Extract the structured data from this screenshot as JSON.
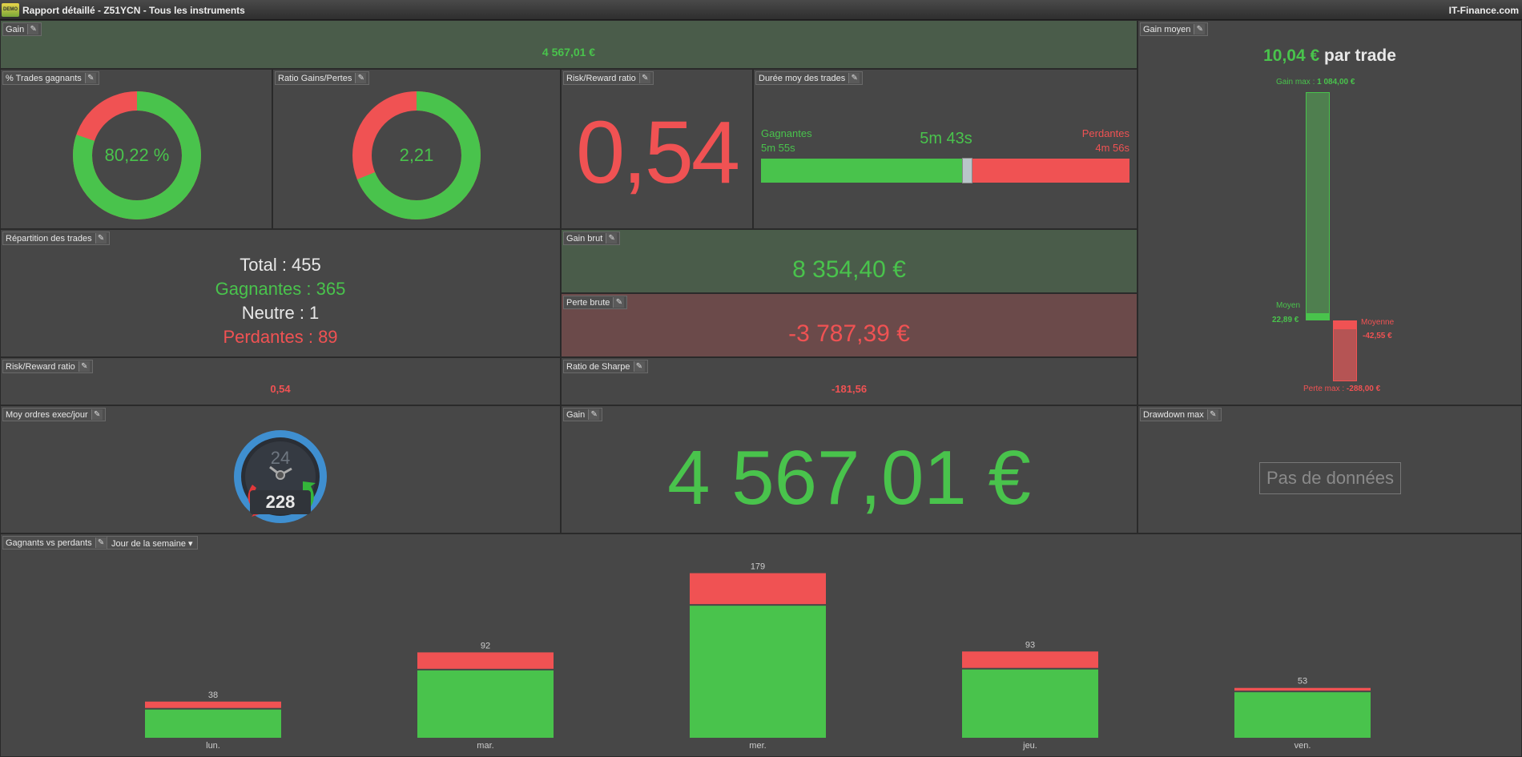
{
  "window": {
    "title": "Rapport détaillé - Z51YCN - Tous les instruments",
    "brand": "IT-Finance.com",
    "logo_text": "DEMO"
  },
  "gain_top": {
    "title": "Gain",
    "value": "4 567,01 €"
  },
  "gain_moyen": {
    "title": "Gain moyen",
    "value": "10,04 €",
    "suffix": "par trade",
    "gain_max_label": "Gain max :",
    "gain_max_value": "1 084,00 €",
    "moyen_label": "Moyen",
    "moyen_value": "22,89 €",
    "moyenne_label": "Moyenne",
    "moyenne_value": "-42,55 €",
    "perte_max_label": "Perte max :",
    "perte_max_value": "-288,00 €"
  },
  "pct_trades_gagnants": {
    "title": "% Trades gagnants",
    "value": "80,22 %",
    "fraction": 0.8022
  },
  "ratio_gains_pertes": {
    "title": "Ratio Gains/Pertes",
    "value": "2,21",
    "fraction": 0.6884
  },
  "risk_reward_big": {
    "title": "Risk/Reward ratio",
    "value": "0,54"
  },
  "duree_moy": {
    "title": "Durée moy des trades",
    "gagnantes_label": "Gagnantes",
    "gagnantes_value": "5m 55s",
    "moyenne_value": "5m 43s",
    "perdantes_label": "Perdantes",
    "perdantes_value": "4m 56s",
    "marker_fraction": 0.545
  },
  "repartition": {
    "title": "Répartition des trades",
    "total": "Total : 455",
    "gagnantes": "Gagnantes : 365",
    "neutre": "Neutre : 1",
    "perdantes": "Perdantes : 89"
  },
  "gain_brut": {
    "title": "Gain brut",
    "value": "8 354,40 €"
  },
  "perte_brute": {
    "title": "Perte brute",
    "value": "-3 787,39 €"
  },
  "risk_reward_small": {
    "title": "Risk/Reward ratio",
    "value": "0,54"
  },
  "sharpe": {
    "title": "Ratio de Sharpe",
    "value": "-181,56"
  },
  "moy_ordres": {
    "title": "Moy ordres exec/jour",
    "value": "228",
    "dial_label": "24"
  },
  "gain_big": {
    "title": "Gain",
    "value": "4 567,01 €"
  },
  "drawdown": {
    "title": "Drawdown max",
    "empty_text": "Pas de données"
  },
  "gagnants_vs_perdants": {
    "title": "Gagnants vs perdants",
    "dropdown": "Jour de la semaine"
  },
  "colors": {
    "green": "#49c34c",
    "red": "#f05253"
  },
  "chart_data": {
    "type": "bar",
    "categories": [
      "lun.",
      "mar.",
      "mer.",
      "jeu.",
      "ven."
    ],
    "series": [
      {
        "name": "Gagnants",
        "values": [
          31,
          74,
          145,
          75,
          50
        ]
      },
      {
        "name": "Perdants",
        "values": [
          7,
          18,
          34,
          18,
          3
        ]
      }
    ],
    "totals": [
      38,
      92,
      179,
      93,
      53
    ],
    "ylim": [
      0,
      190
    ]
  }
}
